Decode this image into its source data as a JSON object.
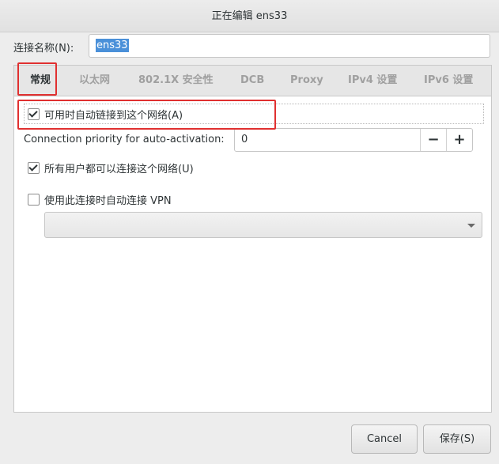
{
  "window": {
    "title": "正在编辑 ens33"
  },
  "connection_name": {
    "label": "连接名称(N):",
    "value": "ens33"
  },
  "tabs": [
    {
      "label": "常规",
      "active": true
    },
    {
      "label": "以太网",
      "active": false
    },
    {
      "label": "802.1X 安全性",
      "active": false
    },
    {
      "label": "DCB",
      "active": false
    },
    {
      "label": "Proxy",
      "active": false
    },
    {
      "label": "IPv4 设置",
      "active": false
    },
    {
      "label": "IPv6 设置",
      "active": false
    }
  ],
  "general": {
    "auto_connect": {
      "label": "可用时自动链接到这个网络(A)",
      "checked": true
    },
    "priority": {
      "label": "Connection priority for auto-activation:",
      "value": "0",
      "minus": "−",
      "plus": "+"
    },
    "all_users": {
      "label": "所有用户都可以连接这个网络(U)",
      "checked": true
    },
    "auto_vpn": {
      "label": "使用此连接时自动连接 VPN",
      "checked": false
    },
    "vpn_select": {
      "value": ""
    }
  },
  "footer": {
    "cancel_label": "Cancel",
    "save_label": "保存(S)"
  },
  "colors": {
    "highlight": "#e03030",
    "selection": "#4a90d9"
  },
  "icons": {
    "checkbox_checked": "check-mark",
    "combo_arrow": "chevron-down-icon"
  }
}
